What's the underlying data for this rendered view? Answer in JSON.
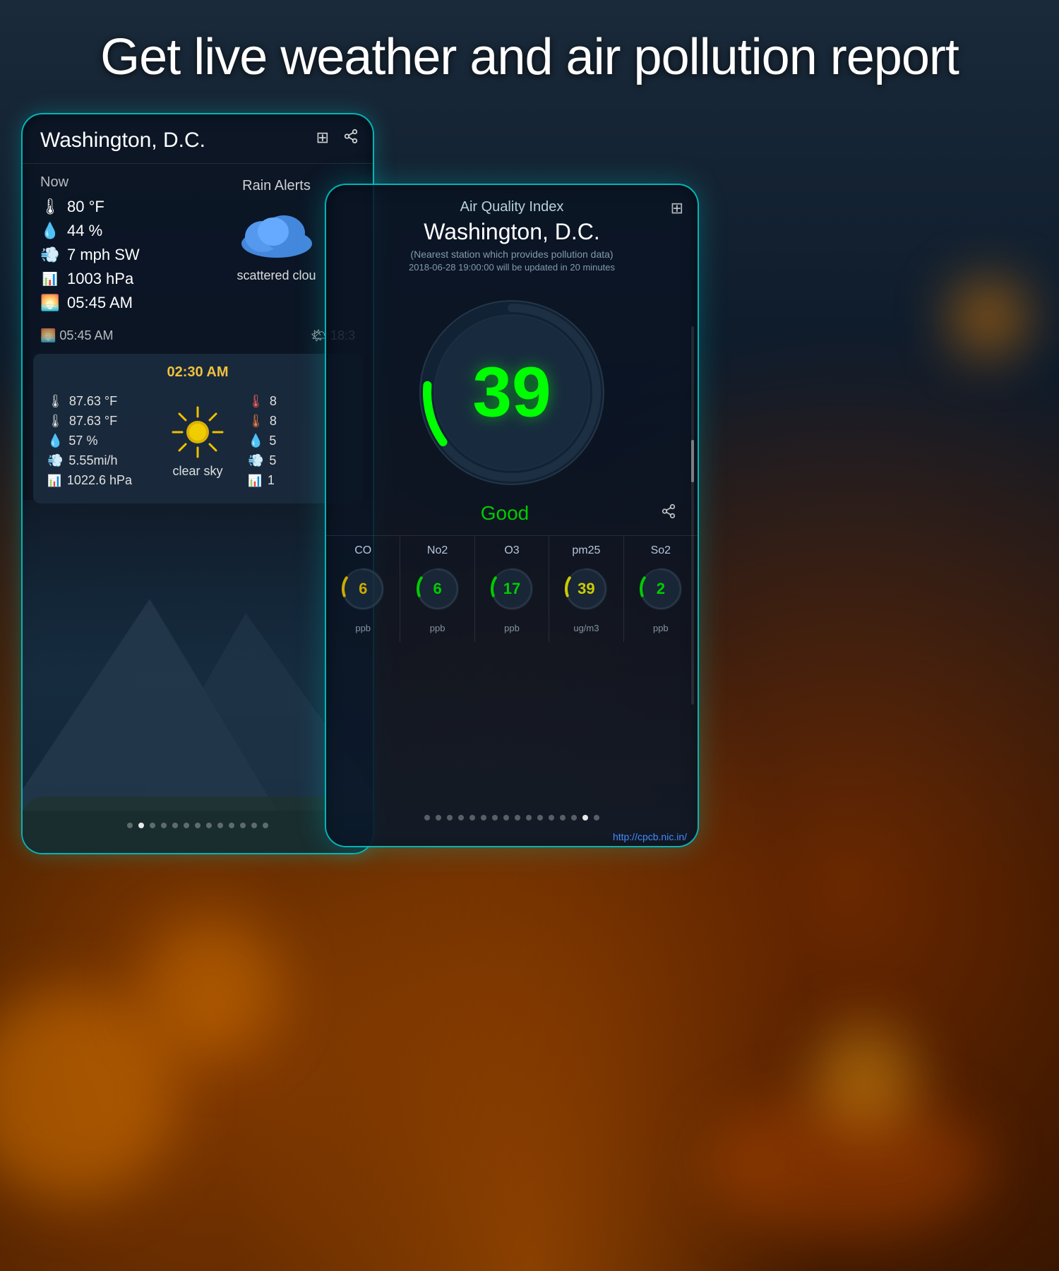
{
  "page": {
    "title": "Get live weather and air pollution report"
  },
  "weather_card": {
    "city": "Washington, D.C.",
    "now_label": "Now",
    "temperature": "80 °F",
    "humidity": "44 %",
    "wind": "7 mph SW",
    "pressure": "1003 hPa",
    "sunrise": "05:45 AM",
    "sunset_time": "18:3",
    "rain_alerts": "Rain Alerts",
    "condition": "scattered clou",
    "icons_btn_1": "⊞",
    "icons_btn_2": "⬡",
    "forecast": {
      "time": "02:30 AM",
      "temp_high": "87.63 °F",
      "temp_low": "87.63 °F",
      "humidity": "57 %",
      "wind": "5.55mi/h",
      "pressure": "1022.6 hPa",
      "condition": "clear sky",
      "temp_high2": "8",
      "temp_low2": "8",
      "humidity2": "5",
      "wind2": "5",
      "pressure2": "1"
    }
  },
  "aqi_card": {
    "title": "Air Quality Index",
    "city": "Washington, D.C.",
    "station": "(Nearest station which provides pollution data)",
    "update_time": "2018-06-28 19:00:00 will be updated in 20 minutes",
    "aqi_value": "39",
    "status": "Good",
    "status_color": "#00cc00",
    "source_link": "http://cpcb.nic.in/",
    "pollutants": [
      {
        "name": "CO",
        "value": "6",
        "unit": "ppb",
        "color": "#ccaa00",
        "arc_color": "#ccaa00"
      },
      {
        "name": "No2",
        "value": "6",
        "unit": "ppb",
        "color": "#00cc00",
        "arc_color": "#00cc00"
      },
      {
        "name": "O3",
        "value": "17",
        "unit": "ppb",
        "color": "#00cc00",
        "arc_color": "#00cc00"
      },
      {
        "name": "pm25",
        "value": "39",
        "unit": "ug/m3",
        "color": "#cccc00",
        "arc_color": "#cccc00"
      },
      {
        "name": "So2",
        "value": "2",
        "unit": "ppb",
        "color": "#00cc00",
        "arc_color": "#00cc00"
      }
    ],
    "dots": [
      "d",
      "d",
      "d",
      "d",
      "d",
      "d",
      "d",
      "d",
      "d",
      "d",
      "d",
      "d",
      "d",
      "d",
      "d",
      "d"
    ],
    "active_dot": 14
  }
}
